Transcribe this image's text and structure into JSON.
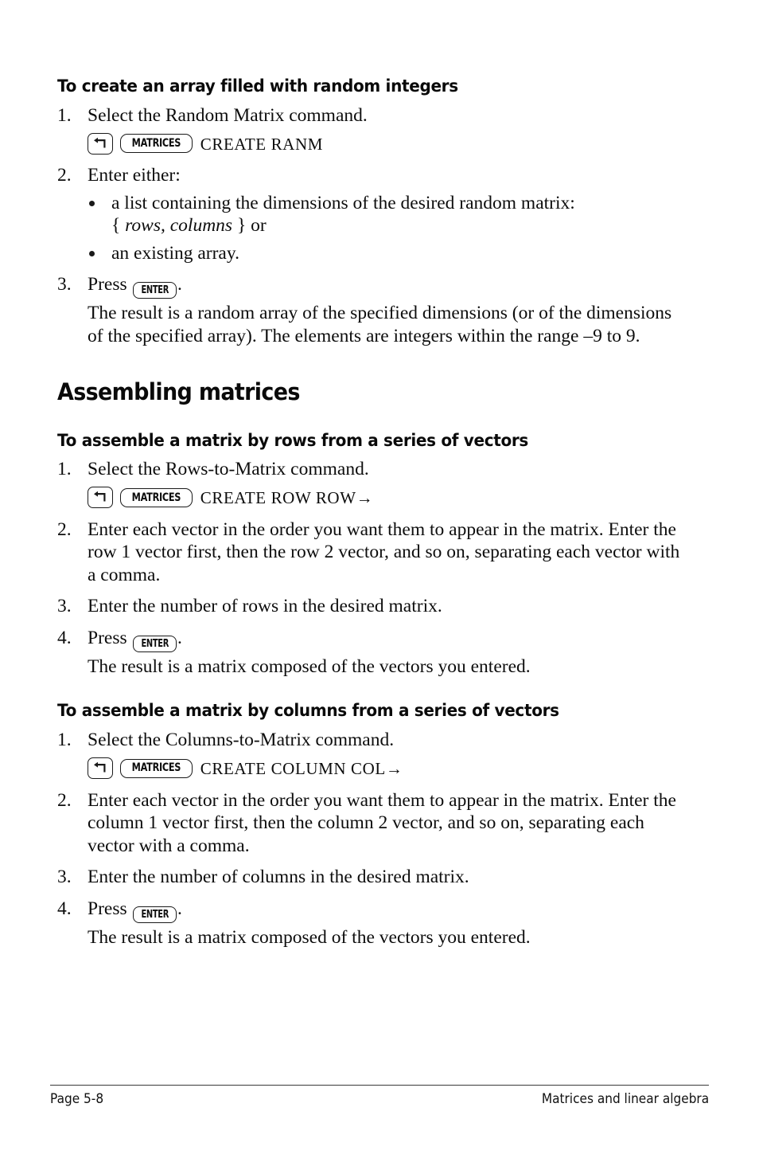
{
  "document": {
    "page_label": "Page 5-8",
    "running_title": "Matrices and linear algebra"
  },
  "sections": [
    {
      "id": "create-random",
      "heading": "To create an array filled with random integers",
      "heading_level": "h2",
      "steps": [
        {
          "num": "1.",
          "text": "Select the Random Matrix command.",
          "key_sequence": {
            "shift_key_icon": "left-shift-arrow-icon",
            "keycap": "MATRICES",
            "command_text": "CREATE RANM"
          }
        },
        {
          "num": "2.",
          "text": "Enter either:",
          "bullets": [
            {
              "pre": "a list containing the dimensions of the desired random matrix:",
              "line2_prefix": "{ ",
              "line2_italic": "rows, columns",
              "line2_suffix": " } or"
            },
            {
              "pre": "an existing array."
            }
          ]
        },
        {
          "num": "3.",
          "press_prefix": "Press ",
          "press_keycap": "ENTER",
          "press_suffix": ".",
          "note": "The result is a random array of the specified dimensions (or of the dimensions of the specified array). The elements are integers within the range –9 to 9."
        }
      ]
    },
    {
      "id": "assembling-matrices",
      "heading": "Assembling matrices",
      "heading_level": "h1"
    },
    {
      "id": "assemble-rows",
      "heading": "To assemble a matrix by rows from a series of vectors",
      "heading_level": "h2",
      "steps": [
        {
          "num": "1.",
          "text": "Select the Rows-to-Matrix command.",
          "key_sequence": {
            "shift_key_icon": "left-shift-arrow-icon",
            "keycap": "MATRICES",
            "command_text": "CREATE ROW ROW→"
          }
        },
        {
          "num": "2.",
          "text": "Enter each vector in the order you want them to appear in the matrix. Enter the row 1 vector first, then the row 2 vector, and so on, separating each vector with a comma."
        },
        {
          "num": "3.",
          "text": "Enter the number of rows in the desired matrix."
        },
        {
          "num": "4.",
          "press_prefix": "Press ",
          "press_keycap": "ENTER",
          "press_suffix": ".",
          "note": "The result is a matrix composed of the vectors you entered."
        }
      ]
    },
    {
      "id": "assemble-columns",
      "heading": "To assemble a matrix by columns from a series of vectors",
      "heading_level": "h2",
      "steps": [
        {
          "num": "1.",
          "text": "Select the Columns-to-Matrix command.",
          "key_sequence": {
            "shift_key_icon": "left-shift-arrow-icon",
            "keycap": "MATRICES",
            "command_text": "CREATE COLUMN COL→"
          }
        },
        {
          "num": "2.",
          "text": "Enter each vector in the order you want them to appear in the matrix. Enter the column 1 vector first, then the column 2 vector, and so on, separating each vector with a comma."
        },
        {
          "num": "3.",
          "text": "Enter the number of columns in the desired matrix."
        },
        {
          "num": "4.",
          "press_prefix": "Press ",
          "press_keycap": "ENTER",
          "press_suffix": ".",
          "note": "The result is a matrix composed of the vectors you entered."
        }
      ]
    }
  ]
}
